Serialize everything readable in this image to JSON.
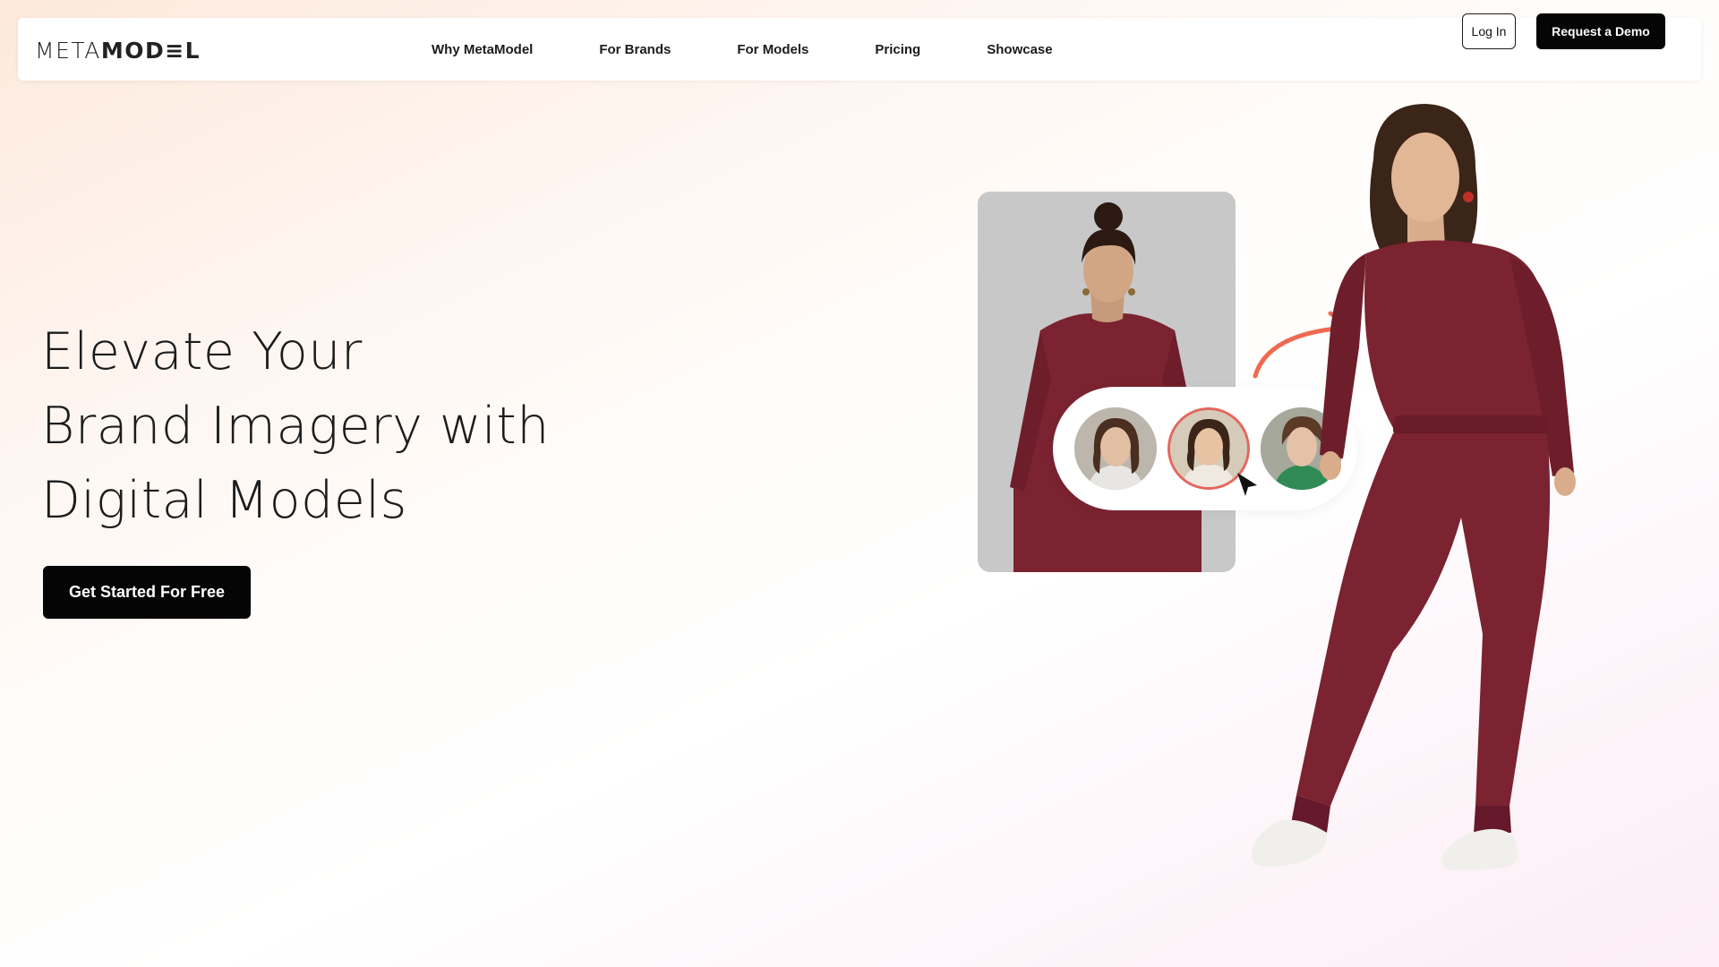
{
  "nav": {
    "logo_light": "META",
    "logo_bold": "MOD≡L",
    "links": [
      "Why MetaModel",
      "For Brands",
      "For Models",
      "Pricing",
      "Showcase"
    ],
    "login_label": "Log In",
    "demo_label": "Request a Demo"
  },
  "hero": {
    "title_lines": [
      "Elevate Your",
      "Brand Imagery with",
      "Digital Models"
    ],
    "cta_label": "Get Started For Free"
  },
  "visual": {
    "outfit_color": "#7b2330",
    "accent_color": "#ee6a50",
    "selected_face_index": 1,
    "icons": [
      "curved-arrow-icon",
      "pointer-cursor-icon"
    ]
  },
  "colors": {
    "button_bg": "#050505",
    "selected_ring": "#e4675e"
  }
}
